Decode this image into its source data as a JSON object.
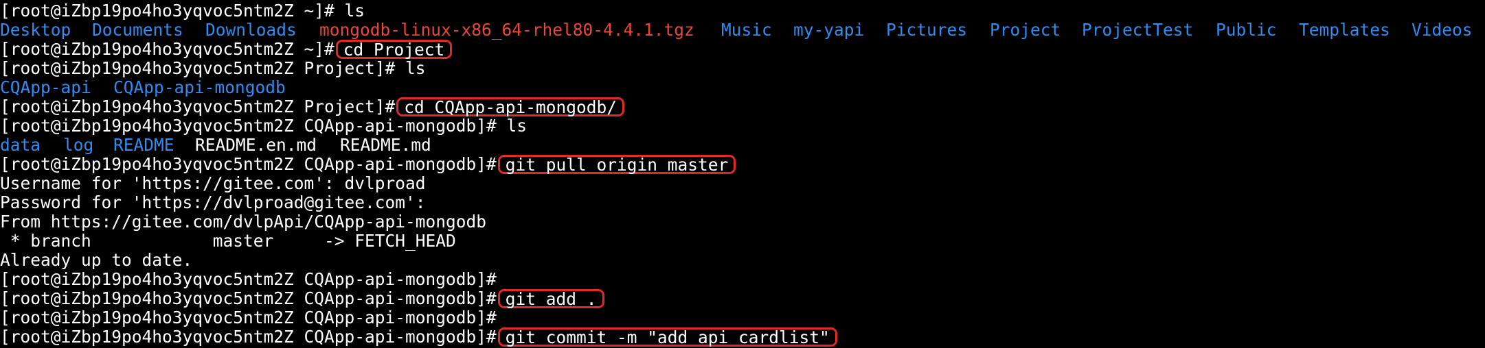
{
  "colors": {
    "background": "#000000",
    "foreground": "#ffffff",
    "directory": "#2f8cf0",
    "archive": "#e8473a",
    "highlight_box": "#e02a25"
  },
  "lines": {
    "l0": {
      "prompt": "[root@iZbp19po4ho3yqvoc5ntm2Z ~]# ",
      "command": "ls"
    },
    "l1": {
      "entries": [
        "Desktop",
        "Documents",
        "Downloads",
        "mongodb-linux-x86_64-rhel80-4.4.1.tgz",
        "Music",
        "my-yapi",
        "Pictures",
        "Project",
        "ProjectTest",
        "Public",
        "Templates",
        "Videos"
      ]
    },
    "l2": {
      "prompt": "[root@iZbp19po4ho3yqvoc5ntm2Z ~]#",
      "command": "cd Project"
    },
    "l3": {
      "prompt": "[root@iZbp19po4ho3yqvoc5ntm2Z Project]# ",
      "command": "ls"
    },
    "l4": {
      "entries": [
        "CQApp-api",
        "CQApp-api-mongodb"
      ]
    },
    "l5": {
      "prompt": "[root@iZbp19po4ho3yqvoc5ntm2Z Project]#",
      "command": "cd CQApp-api-mongodb/"
    },
    "l6": {
      "prompt": "[root@iZbp19po4ho3yqvoc5ntm2Z CQApp-api-mongodb]# ",
      "command": "ls"
    },
    "l7": {
      "entries": [
        "data",
        "log",
        "README",
        "README.en.md",
        "README.md"
      ]
    },
    "l8": {
      "prompt": "[root@iZbp19po4ho3yqvoc5ntm2Z CQApp-api-mongodb]#",
      "command": "git pull origin master"
    },
    "l9": {
      "text": "Username for 'https://gitee.com': dvlproad"
    },
    "l10": {
      "text": "Password for 'https://dvlproad@gitee.com':"
    },
    "l11": {
      "text": "From https://gitee.com/dvlpApi/CQApp-api-mongodb"
    },
    "l12": {
      "text": " * branch            master     -> FETCH_HEAD"
    },
    "l13": {
      "text": "Already up to date."
    },
    "l14": {
      "prompt": "[root@iZbp19po4ho3yqvoc5ntm2Z CQApp-api-mongodb]#"
    },
    "l15": {
      "prompt": "[root@iZbp19po4ho3yqvoc5ntm2Z CQApp-api-mongodb]#",
      "command": "git add ."
    },
    "l16": {
      "prompt": "[root@iZbp19po4ho3yqvoc5ntm2Z CQApp-api-mongodb]#"
    },
    "l17": {
      "prompt": "[root@iZbp19po4ho3yqvoc5ntm2Z CQApp-api-mongodb]#",
      "command": "git commit -m \"add api cardlist\""
    }
  }
}
